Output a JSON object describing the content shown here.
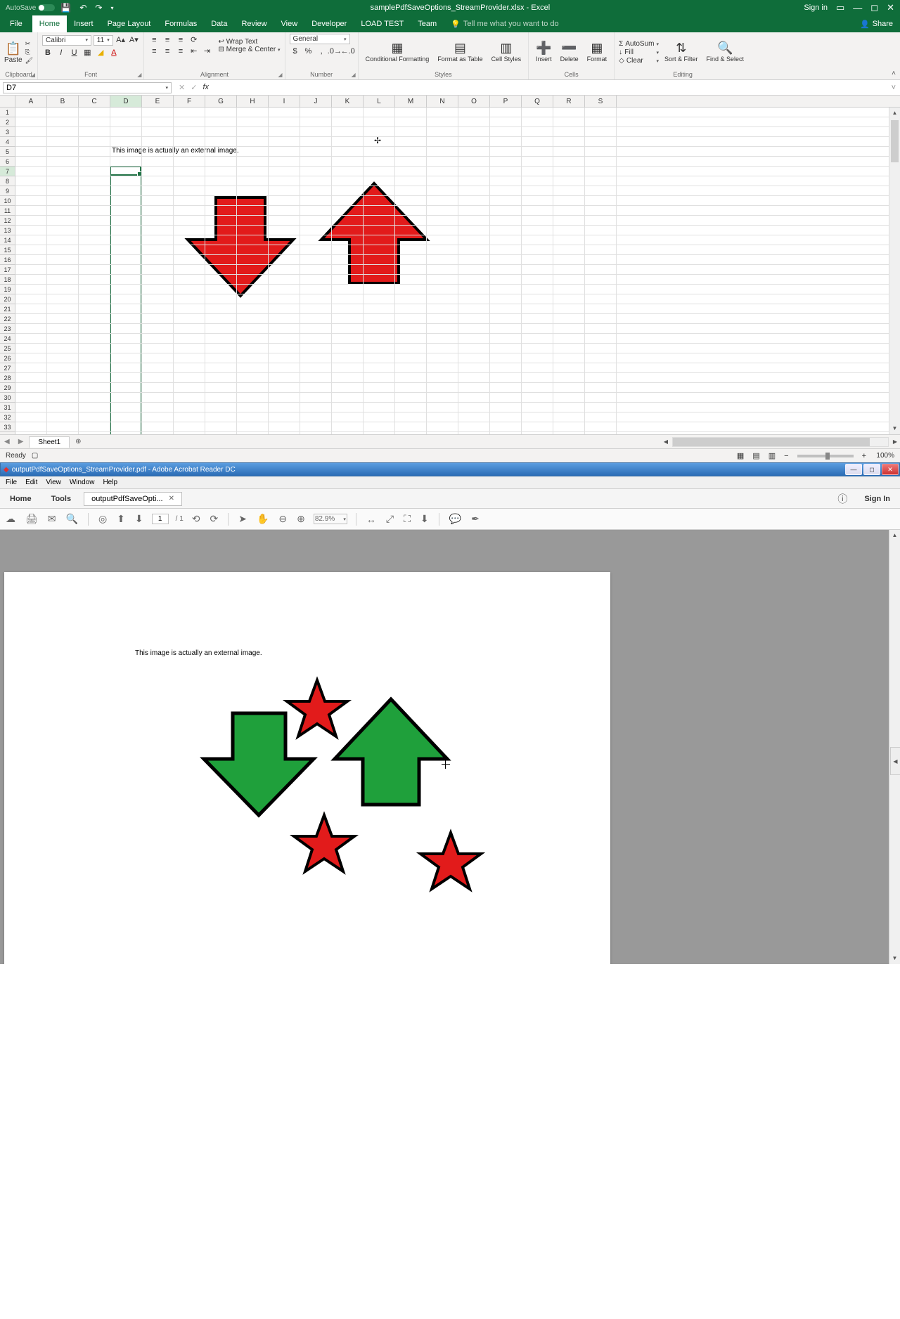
{
  "excel": {
    "titlebar": {
      "autosave_label": "AutoSave",
      "autosave_state": "Off",
      "title": "samplePdfSaveOptions_StreamProvider.xlsx - Excel",
      "sign_in": "Sign in"
    },
    "menu": {
      "file": "File",
      "tabs": [
        "Home",
        "Insert",
        "Page Layout",
        "Formulas",
        "Data",
        "Review",
        "View",
        "Developer",
        "LOAD TEST",
        "Team"
      ],
      "active_tab": "Home",
      "tell_me": "Tell me what you want to do",
      "share": "Share"
    },
    "ribbon": {
      "clipboard": {
        "label": "Clipboard",
        "paste": "Paste",
        "cut": "Cut",
        "copy": "Copy",
        "format_painter": "Format Painter"
      },
      "font": {
        "label": "Font",
        "name": "Calibri",
        "size": "11"
      },
      "alignment": {
        "label": "Alignment",
        "wrap": "Wrap Text",
        "merge": "Merge & Center"
      },
      "number": {
        "label": "Number",
        "format": "General"
      },
      "styles": {
        "label": "Styles",
        "cond": "Conditional Formatting",
        "table": "Format as Table",
        "cell": "Cell Styles"
      },
      "cells": {
        "label": "Cells",
        "insert": "Insert",
        "delete": "Delete",
        "format": "Format"
      },
      "editing": {
        "label": "Editing",
        "autosum": "AutoSum",
        "fill": "Fill",
        "clear": "Clear",
        "sort": "Sort & Filter",
        "find": "Find & Select"
      }
    },
    "namebox": "D7",
    "formula": "",
    "columns": [
      "A",
      "B",
      "C",
      "D",
      "E",
      "F",
      "G",
      "H",
      "I",
      "J",
      "K",
      "L",
      "M",
      "N",
      "O",
      "P",
      "Q",
      "R",
      "S"
    ],
    "selected_column": "D",
    "selected_row": 7,
    "cell_d5": "This image is actually an external image.",
    "sheet_tab": "Sheet1",
    "status": {
      "ready": "Ready",
      "zoom": "100%"
    }
  },
  "acrobat": {
    "titlebar": "outputPdfSaveOptions_StreamProvider.pdf - Adobe Acrobat Reader DC",
    "menu": [
      "File",
      "Edit",
      "View",
      "Window",
      "Help"
    ],
    "tabs": {
      "home": "Home",
      "tools": "Tools",
      "doc": "outputPdfSaveOpti...",
      "signin": "Sign In"
    },
    "toolbar": {
      "page": "1",
      "total": "/ 1",
      "zoom": "82.9%"
    },
    "page_text": "This image is actually an external image."
  }
}
